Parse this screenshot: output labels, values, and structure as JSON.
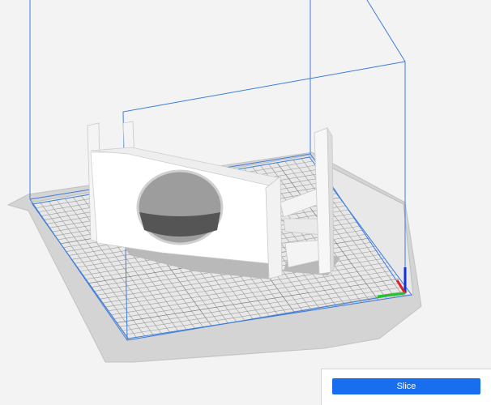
{
  "viewport": {
    "description_icon": "build-plate-3d-view",
    "colors": {
      "background": "#f3f3f3",
      "plate": "#d9d9d9",
      "grid": "#9a9a9a",
      "build_volume": "#3c7ddc",
      "model": "#ffffff",
      "shadow": "#b4b4b4",
      "axis_x": "#e0201c",
      "axis_y": "#22c42a",
      "axis_z": "#1030e0"
    }
  },
  "slice_panel": {
    "button_label": "Slice",
    "button_color": "#196ef0"
  }
}
